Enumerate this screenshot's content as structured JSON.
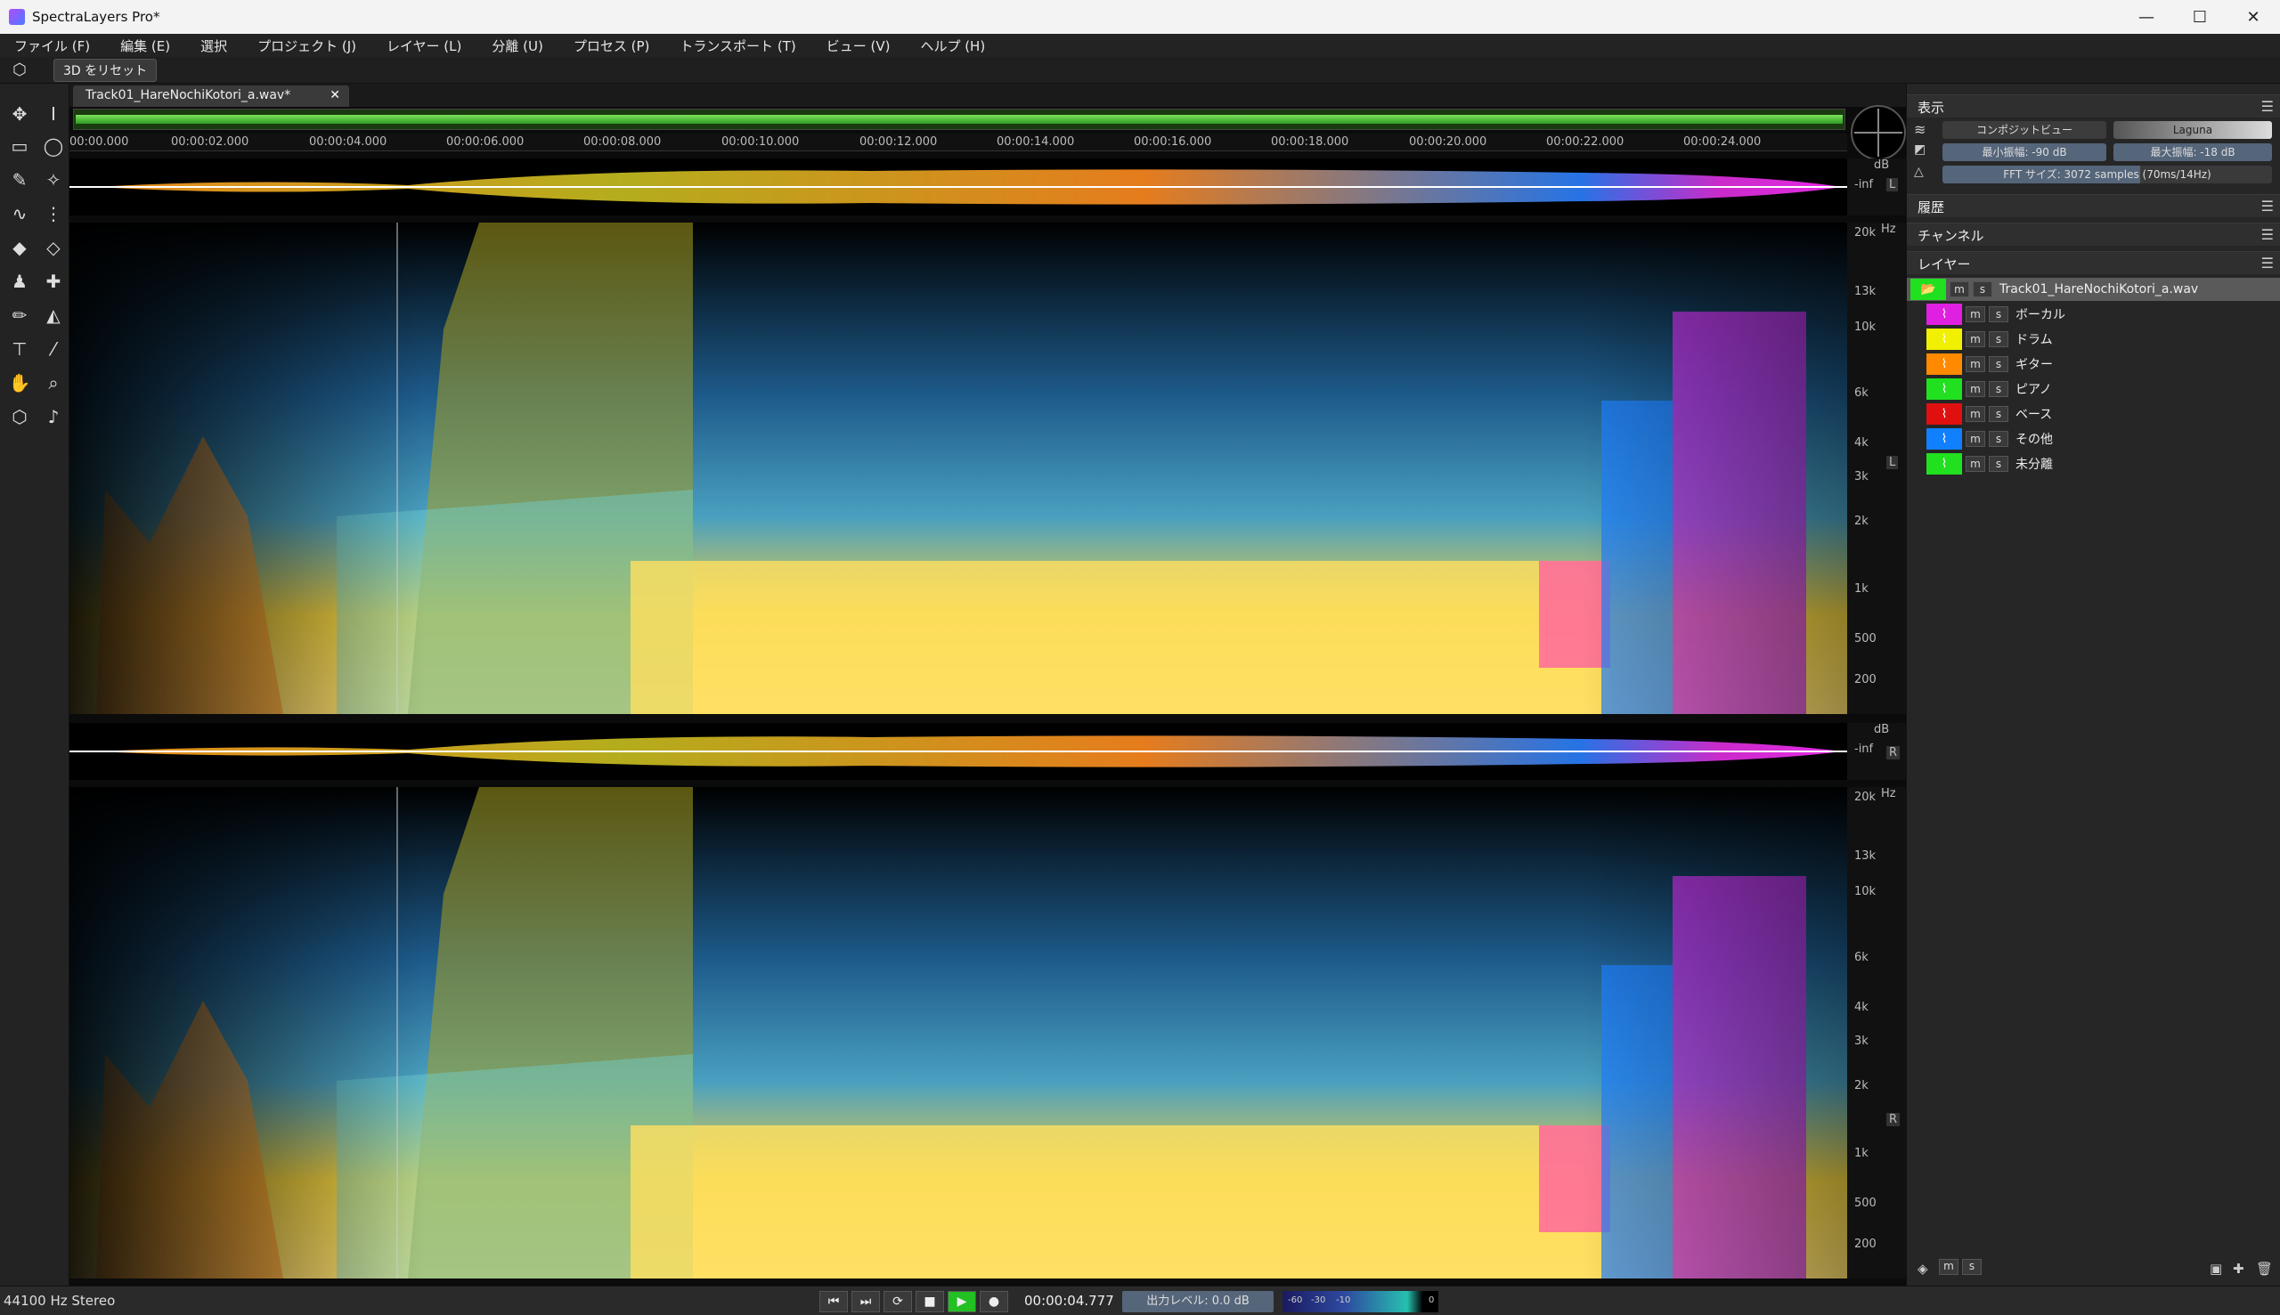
{
  "window": {
    "title": "SpectraLayers Pro*",
    "minimize": "—",
    "maximize": "☐",
    "close": "✕"
  },
  "menu": [
    "ファイル (F)",
    "編集 (E)",
    "選択",
    "プロジェクト (J)",
    "レイヤー (L)",
    "分離 (U)",
    "プロセス (P)",
    "トランスポート (T)",
    "ビュー (V)",
    "ヘルプ (H)"
  ],
  "toolbar": {
    "reset_3d": "3D をリセット"
  },
  "tab": {
    "label": "Track01_HareNochiKotori_a.wav*",
    "close": "✕"
  },
  "ruler": [
    "00:00.000",
    "00:00:02.000",
    "00:00:04.000",
    "00:00:06.000",
    "00:00:08.000",
    "00:00:10.000",
    "00:00:12.000",
    "00:00:14.000",
    "00:00:16.000",
    "00:00:18.000",
    "00:00:20.000",
    "00:00:22.000",
    "00:00:24.000"
  ],
  "wave_scale": {
    "db": "dB",
    "inf": "-inf"
  },
  "channels": {
    "left": "L",
    "right": "R"
  },
  "freq_scale": {
    "unit": "Hz",
    "labels": [
      "20k",
      "13k",
      "10k",
      "6k",
      "4k",
      "3k",
      "2k",
      "1k",
      "500",
      "200"
    ]
  },
  "panel": {
    "display_title": "表示",
    "composite_view": "コンポジットビュー",
    "palette": "Laguna",
    "min_amp": "最小振幅: -90 dB",
    "max_amp": "最大振幅: -18 dB",
    "fft": "FFT サイズ: 3072 samples (70ms/14Hz)",
    "history_title": "履歴",
    "channel_title": "チャンネル",
    "layers_title": "レイヤー",
    "track_name": "Track01_HareNochiKotori_a.wav",
    "m": "m",
    "s": "s",
    "layers": [
      {
        "name": "ボーカル",
        "color": "#e020e0"
      },
      {
        "name": "ドラム",
        "color": "#f0f000"
      },
      {
        "name": "ギター",
        "color": "#ff8a00"
      },
      {
        "name": "ピアノ",
        "color": "#20e020"
      },
      {
        "name": "ベース",
        "color": "#e01010"
      },
      {
        "name": "その他",
        "color": "#1080ff"
      },
      {
        "name": "未分離",
        "color": "#20e020"
      }
    ]
  },
  "status": {
    "format": "44100 Hz Stereo",
    "timecode": "00:00:04.777",
    "output_level": "出力レベル: 0.0 dB",
    "meter_labels": [
      "-60",
      "-30",
      "-10",
      "0"
    ]
  }
}
